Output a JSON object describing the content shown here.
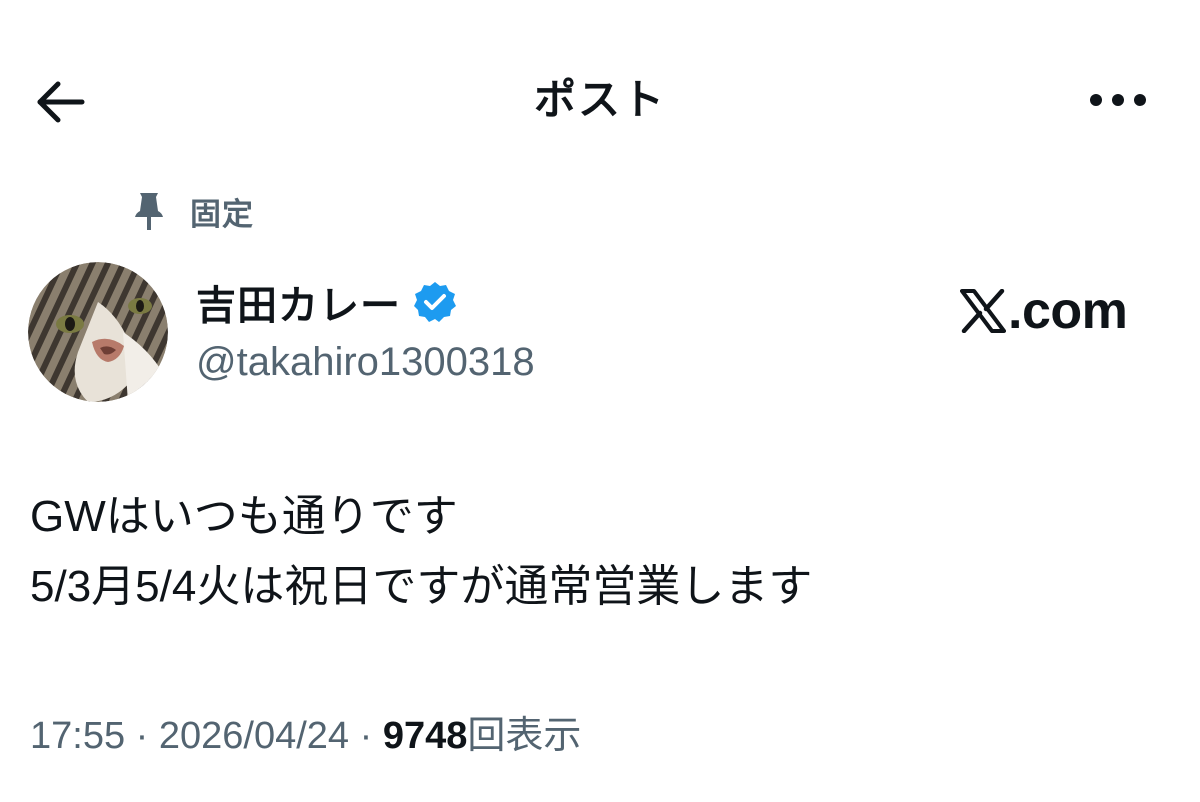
{
  "header": {
    "title": "ポスト",
    "back_icon": "arrow-left-icon",
    "more_icon": "more-horizontal-icon"
  },
  "pinned": {
    "icon": "pin-icon",
    "label": "固定"
  },
  "author": {
    "name": "吉田カレー",
    "handle": "@takahiro1300318",
    "verified_color": "#1d9bf0",
    "avatar_icon": "cat-avatar"
  },
  "watermark": {
    "logo_icon": "x-logo-icon",
    "text": ".com"
  },
  "post": {
    "lines": [
      "GWはいつも通りです",
      "5/3月5/4火は祝日ですが通常営業します"
    ]
  },
  "meta": {
    "time": "17:55",
    "separator": " · ",
    "date": "2026/04/24",
    "views_count": "9748",
    "views_label": "回表示"
  },
  "colors": {
    "text_primary": "#0f1419",
    "text_secondary": "#536471",
    "accent": "#1d9bf0"
  }
}
